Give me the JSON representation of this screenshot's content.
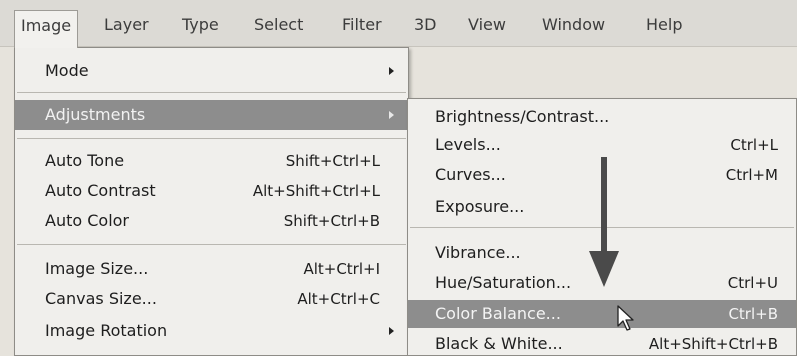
{
  "menubar": {
    "items": [
      "Image",
      "Layer",
      "Type",
      "Select",
      "Filter",
      "3D",
      "View",
      "Window",
      "Help"
    ]
  },
  "dropdown": {
    "items": [
      {
        "label": "Mode",
        "shortcut": "",
        "submenu": true
      },
      {
        "label": "Adjustments",
        "shortcut": "",
        "submenu": true,
        "highlighted": true
      },
      {
        "label": "Auto Tone",
        "shortcut": "Shift+Ctrl+L"
      },
      {
        "label": "Auto Contrast",
        "shortcut": "Alt+Shift+Ctrl+L"
      },
      {
        "label": "Auto Color",
        "shortcut": "Shift+Ctrl+B"
      },
      {
        "label": "Image Size...",
        "shortcut": "Alt+Ctrl+I"
      },
      {
        "label": "Canvas Size...",
        "shortcut": "Alt+Ctrl+C"
      },
      {
        "label": "Image Rotation",
        "shortcut": "",
        "submenu": true
      }
    ]
  },
  "submenu": {
    "items": [
      {
        "label": "Brightness/Contrast...",
        "shortcut": ""
      },
      {
        "label": "Levels...",
        "shortcut": "Ctrl+L"
      },
      {
        "label": "Curves...",
        "shortcut": "Ctrl+M"
      },
      {
        "label": "Exposure...",
        "shortcut": ""
      },
      {
        "label": "Vibrance...",
        "shortcut": ""
      },
      {
        "label": "Hue/Saturation...",
        "shortcut": "Ctrl+U"
      },
      {
        "label": "Color Balance...",
        "shortcut": "Ctrl+B",
        "highlighted": true
      },
      {
        "label": "Black & White...",
        "shortcut": "Alt+Shift+Ctrl+B"
      }
    ]
  },
  "colors": {
    "highlight": "#8d8d8d",
    "menu_bg": "#f0efec",
    "menubar_bg": "#dcdad5"
  }
}
